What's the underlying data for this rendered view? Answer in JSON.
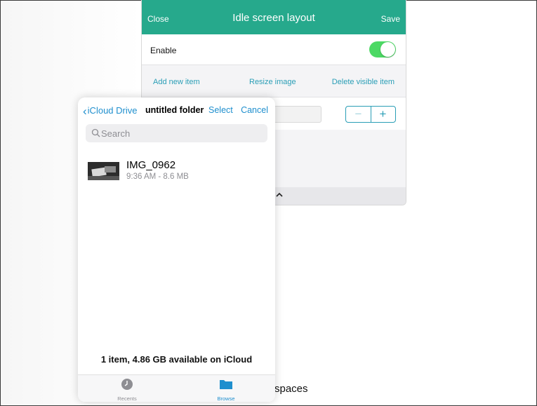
{
  "idle_layout": {
    "close_label": "Close",
    "title": "Idle screen layout",
    "save_label": "Save",
    "enable_label": "Enable",
    "enable_on": true,
    "actions": {
      "add": "Add new item",
      "resize": "Resize image",
      "delete": "Delete visible item"
    },
    "stepper": {
      "minus": "−",
      "plus": "+"
    },
    "chevron": "^"
  },
  "background_text": "spaces",
  "picker": {
    "back_label": "iCloud Drive",
    "back_chevron": "‹",
    "folder_title": "untitled folder",
    "select_label": "Select",
    "cancel_label": "Cancel",
    "search_placeholder": "Search",
    "files": [
      {
        "name": "IMG_0962",
        "meta": "9:36 AM - 8.6 MB"
      }
    ],
    "footer_info": "1 item, 4.86 GB available on iCloud",
    "tabs": [
      {
        "label": "Recents",
        "icon": "clock-icon",
        "selected": false
      },
      {
        "label": "Browse",
        "icon": "folder-icon",
        "selected": true
      }
    ]
  },
  "colors": {
    "header_green": "#26a98c",
    "toggle_green": "#4cd964",
    "accent_blue": "#1f8fce",
    "action_teal": "#2a9eb6"
  }
}
